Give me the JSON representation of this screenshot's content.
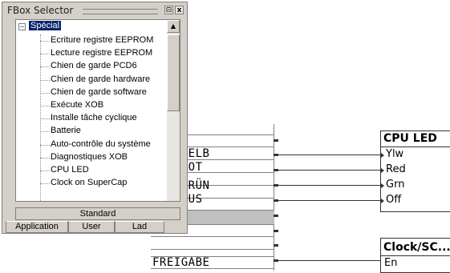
{
  "selector": {
    "title": "FBox Selector",
    "root_label": "Spécial",
    "collapse_glyph": "−",
    "items": [
      "Ecriture registre EEPROM",
      "Lecture registre EEPROM",
      "Chien de garde PCD6",
      "Chien de garde hardware",
      "Chien de garde software",
      "Exécute XOB",
      "Installe tâche cyclique",
      "Batterie",
      "Auto-contrôle du système",
      "Diagnostiques XOB",
      "CPU LED",
      "Clock on SuperCap"
    ],
    "standard_label": "Standard",
    "tabs": [
      "Application",
      "User",
      "Lad"
    ],
    "close_glyph": "x",
    "restore_glyph": "⊟",
    "scroll_up_glyph": "▲"
  },
  "fupla": {
    "signals": [
      "LED_GELB",
      "LED_ROT",
      "LED_GRÜN",
      "LED_AUS",
      "FREIGABE"
    ],
    "cpu_led": {
      "title": "CPU LED",
      "pins": [
        "Ylw",
        "Red",
        "Grn",
        "Off"
      ]
    },
    "clock": {
      "title": "Clock/SC...",
      "pins": [
        "En"
      ]
    }
  }
}
